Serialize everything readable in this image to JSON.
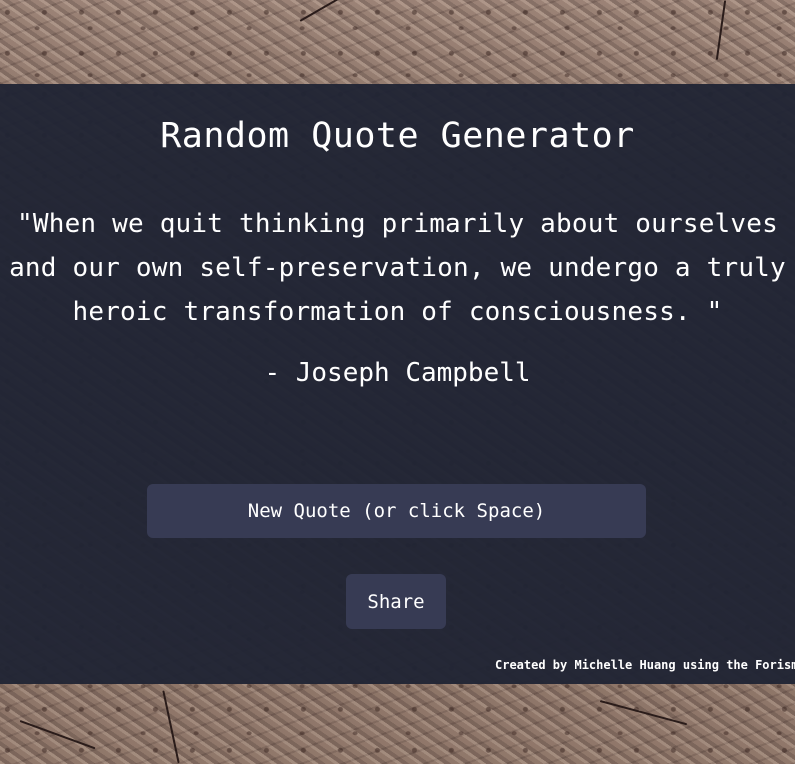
{
  "app": {
    "title": "Random Quote Generator"
  },
  "quote": {
    "text": "\"When we quit thinking primarily about ourselves and our own self-preservation, we undergo a truly heroic transformation of consciousness. \"",
    "author": "- Joseph Campbell"
  },
  "buttons": {
    "new_quote_label": "New Quote (or click Space)",
    "share_label": "Share"
  },
  "footer": {
    "credit": "Created by Michelle Huang using the Forisma"
  },
  "colors": {
    "panel": "#202434",
    "button": "#373b54",
    "text": "#ffffff"
  }
}
